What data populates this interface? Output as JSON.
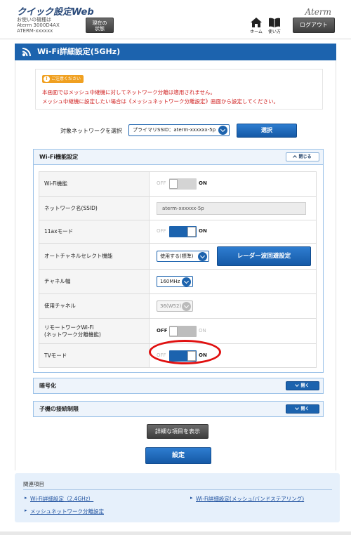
{
  "header": {
    "app_title": "クイック設定Web",
    "device_line1": "お使いの機種は",
    "device_line2": "Aterm 3000D4AX",
    "device_line3": "ATERM-xxxxxx",
    "status_button": [
      "現在の",
      "状態"
    ],
    "brand": "Aterm",
    "home_label": "ホーム",
    "help_label": "使い方",
    "logout_label": "ログアウト"
  },
  "page_title": "Wi-Fi詳細設定(5GHz)",
  "caution": {
    "badge": "ご注意ください",
    "line1": "本画面ではメッシュ中継機に対してネットワーク分離は適用されません。",
    "line2": "メッシュ中継機に設定したい場合は《メッシュネットワーク分離設定》画面から設定してください。"
  },
  "target_network": {
    "label": "対象ネットワークを選択",
    "selected": "プライマリSSID：aterm-xxxxxx-5p",
    "select_button": "選択"
  },
  "wifi_section": {
    "title": "Wi-Fi機能設定",
    "toggle_label": "閉じる",
    "rows": [
      {
        "label": "Wi-Fi機能",
        "off": "OFF",
        "on": "ON",
        "state": "off"
      },
      {
        "label": "ネットワーク名(SSID)",
        "value": "aterm-xxxxxx-5p"
      },
      {
        "label": "11axモード",
        "off": "OFF",
        "on": "ON",
        "state": "on"
      },
      {
        "label": "オートチャネルセレクト機能",
        "value": "使用する(標準)",
        "button": "レーダー波回避設定"
      },
      {
        "label": "チャネル幅",
        "value": "160MHz"
      },
      {
        "label": "使用チャネル",
        "value": "36(W52)"
      },
      {
        "label_line1": "リモートワークWi-Fi",
        "label_line2": "(ネットワーク分離機能)",
        "off": "OFF",
        "on": "ON",
        "state": "off"
      },
      {
        "label": "TVモード",
        "off": "OFF",
        "on": "ON",
        "state": "on"
      }
    ]
  },
  "encryption_section": {
    "title": "暗号化",
    "toggle_label": "開く"
  },
  "connection_limit_section": {
    "title": "子機の接続制限",
    "toggle_label": "開く"
  },
  "show_details_button": "詳細な項目を表示",
  "set_button": "設定",
  "related": {
    "title": "関連項目",
    "links": [
      "Wi-Fi詳細設定（2.4GHz）",
      "Wi-Fi詳細設定(メッシュ/バンドステアリング)",
      "メッシュネットワーク分離設定"
    ]
  },
  "colors": {
    "primary": "#1c63ae",
    "caution_text": "#d02020",
    "badge": "#f0a020",
    "highlight_circle": "#e01010"
  }
}
